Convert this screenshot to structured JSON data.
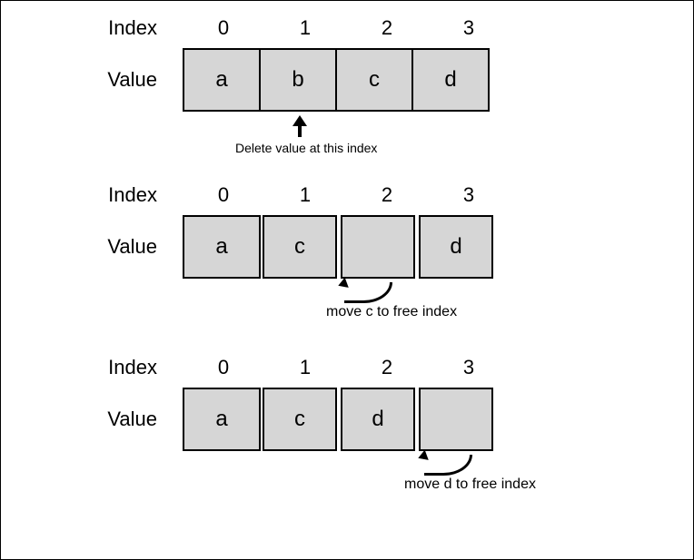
{
  "labels": {
    "index": "Index",
    "value": "Value"
  },
  "stages": [
    {
      "indices": [
        "0",
        "1",
        "2",
        "3"
      ],
      "values": [
        "a",
        "b",
        "c",
        "d"
      ],
      "pointer_index": 1,
      "pointer_kind": "up",
      "caption": "Delete value at this index"
    },
    {
      "indices": [
        "0",
        "1",
        "2",
        "3"
      ],
      "values": [
        "a",
        "c",
        "",
        "d"
      ],
      "pointer_index": 2,
      "pointer_kind": "curve",
      "caption": "move c to free index"
    },
    {
      "indices": [
        "0",
        "1",
        "2",
        "3"
      ],
      "values": [
        "a",
        "c",
        "d",
        ""
      ],
      "pointer_index": 3,
      "pointer_kind": "curve",
      "caption": "move d to free index"
    }
  ]
}
